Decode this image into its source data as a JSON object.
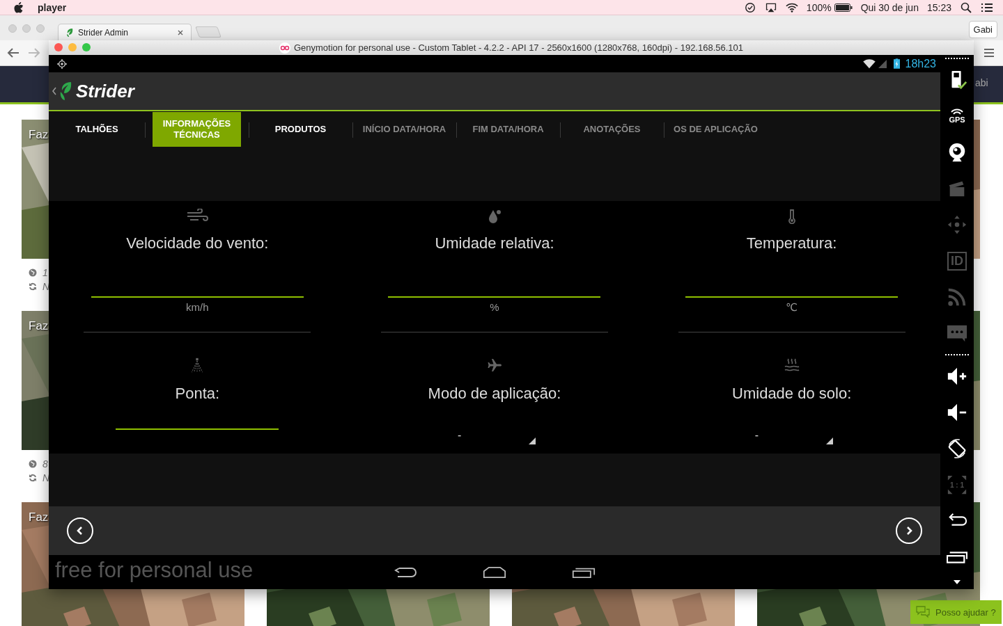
{
  "menu_bar": {
    "app": "player",
    "battery": "100%",
    "date": "Qui 30 de jun",
    "time": "15:23"
  },
  "browser": {
    "tab": "Strider Admin",
    "profile": "Gabi",
    "user": "abi",
    "cards": [
      {
        "title": "Faz",
        "area": "1",
        "status": "N"
      },
      {
        "title": "Faz",
        "area": "8",
        "status": "N"
      },
      {
        "title": "Faz"
      }
    ],
    "help_button": "Posso ajudar ?"
  },
  "emulator": {
    "title": "Genymotion for personal use - Custom Tablet - 4.2.2 - API 17 - 2560x1600 (1280x768, 160dpi) - 192.168.56.101",
    "clock": "18h23",
    "app_title": "Strider",
    "tabs": [
      {
        "label": "TALHÕES",
        "selected": false,
        "disabled": false
      },
      {
        "label": "INFORMAÇÕES TÉCNICAS",
        "selected": true,
        "disabled": false
      },
      {
        "label": "PRODUTOS",
        "selected": false,
        "disabled": false
      },
      {
        "label": "INÍCIO DATA/HORA",
        "selected": false,
        "disabled": true
      },
      {
        "label": "FIM DATA/HORA",
        "selected": false,
        "disabled": true
      },
      {
        "label": "ANOTAÇÕES",
        "selected": false,
        "disabled": true
      },
      {
        "label": "OS DE APLICAÇÃO",
        "selected": false,
        "disabled": true
      }
    ],
    "fields": [
      {
        "kind": "input",
        "label": "Velocidade do vento:",
        "unit": "km/h"
      },
      {
        "kind": "input",
        "label": "Umidade relativa:",
        "unit": "%"
      },
      {
        "kind": "input",
        "label": "Temperatura:",
        "unit": "℃"
      },
      {
        "kind": "input",
        "label": "Ponta:"
      },
      {
        "kind": "select",
        "label": "Modo de aplicação:",
        "value": "-"
      },
      {
        "kind": "select",
        "label": "Umidade do solo:",
        "value": "-"
      }
    ],
    "watermark": "free for personal use",
    "tools": [
      {
        "kind": "separator"
      },
      {
        "kind": "battery",
        "disabled": false
      },
      {
        "kind": "gps",
        "label": "GPS",
        "disabled": false
      },
      {
        "kind": "camera",
        "disabled": false
      },
      {
        "kind": "clapper",
        "disabled": true
      },
      {
        "kind": "move",
        "disabled": true
      },
      {
        "kind": "id",
        "label": "ID",
        "disabled": true
      },
      {
        "kind": "rss",
        "disabled": true
      },
      {
        "kind": "chat",
        "disabled": true
      },
      {
        "kind": "separator"
      },
      {
        "kind": "volume_up",
        "disabled": false
      },
      {
        "kind": "volume_down",
        "disabled": false
      },
      {
        "kind": "rotate",
        "disabled": false
      },
      {
        "kind": "scale",
        "label": "1 : 1",
        "disabled": true
      },
      {
        "kind": "back",
        "disabled": false
      },
      {
        "kind": "recents",
        "disabled": false
      },
      {
        "kind": "more",
        "disabled": false
      }
    ]
  }
}
